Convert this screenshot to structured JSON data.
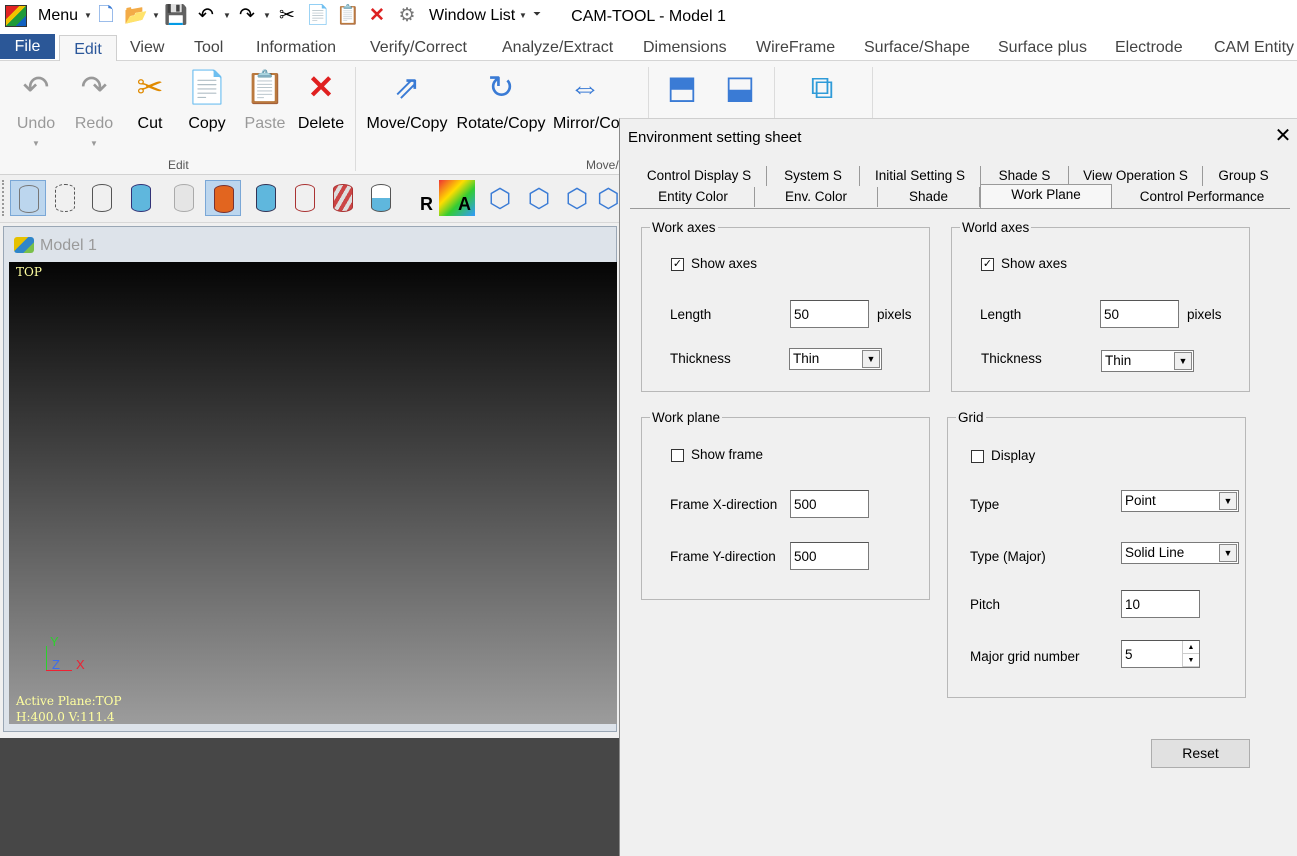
{
  "app": {
    "menu_label": "Menu",
    "window_list_label": "Window List",
    "title": "CAM-TOOL - Model 1"
  },
  "ribbon_tabs": [
    "File",
    "Edit",
    "View",
    "Tool",
    "Information",
    "Verify/Correct",
    "Analyze/Extract",
    "Dimensions",
    "WireFrame",
    "Surface/Shape",
    "Surface plus",
    "Electrode",
    "CAM Entity"
  ],
  "ribbon": {
    "undo": "Undo",
    "redo": "Redo",
    "cut": "Cut",
    "copy": "Copy",
    "paste": "Paste",
    "delete": "Delete",
    "move_copy": "Move/Copy",
    "rotate_copy": "Rotate/Copy",
    "mirror_copy": "Mirror/Co",
    "group_edit": "Edit",
    "group_move": "Move/"
  },
  "model_window": {
    "title": "Model 1",
    "view_name": "TOP",
    "axis_y": "Y",
    "axis_z": "Z",
    "axis_x": "X",
    "active_plane": "Active Plane:TOP",
    "coords": "H:400.0 V:111.4"
  },
  "dialog": {
    "title": "Environment setting sheet",
    "tabs_row1": [
      "Control Display S",
      "System S",
      "Initial Setting S",
      "Shade S",
      "View Operation S",
      "Group S"
    ],
    "tabs_row2": [
      "Entity Color",
      "Env. Color",
      "Shade",
      "Work Plane",
      "Control Performance"
    ],
    "selected_tab": "Work Plane",
    "work_axes": {
      "legend": "Work axes",
      "show_axes_label": "Show axes",
      "show_axes_checked": true,
      "length_label": "Length",
      "length_value": "50",
      "length_unit": "pixels",
      "thickness_label": "Thickness",
      "thickness_value": "Thin"
    },
    "world_axes": {
      "legend": "World axes",
      "show_axes_label": "Show axes",
      "show_axes_checked": true,
      "length_label": "Length",
      "length_value": "50",
      "length_unit": "pixels",
      "thickness_label": "Thickness",
      "thickness_value": "Thin"
    },
    "work_plane": {
      "legend": "Work plane",
      "show_frame_label": "Show frame",
      "show_frame_checked": false,
      "frame_x_label": "Frame X-direction",
      "frame_x_value": "500",
      "frame_y_label": "Frame Y-direction",
      "frame_y_value": "500"
    },
    "grid": {
      "legend": "Grid",
      "display_label": "Display",
      "display_checked": false,
      "type_label": "Type",
      "type_value": "Point",
      "type_major_label": "Type (Major)",
      "type_major_value": "Solid Line",
      "pitch_label": "Pitch",
      "pitch_value": "10",
      "major_grid_label": "Major grid number",
      "major_grid_value": "5"
    },
    "reset_label": "Reset"
  }
}
